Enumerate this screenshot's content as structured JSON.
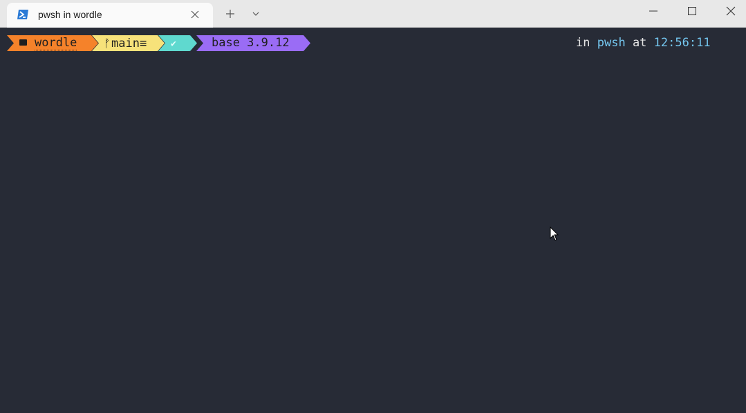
{
  "tab": {
    "title": "pwsh in wordle",
    "icon": "powershell-icon"
  },
  "titlebar": {
    "new_tab_icon": "plus-icon",
    "dropdown_icon": "chevron-down-icon",
    "minimize_icon": "minimize-icon",
    "maximize_icon": "maximize-icon",
    "close_icon": "close-icon"
  },
  "prompt": {
    "path": "wordle",
    "branch": "main≡",
    "status_icon": "check-icon",
    "python": "base 3.9.12"
  },
  "right_prompt": {
    "in_label": "in",
    "shell": "pwsh",
    "at_label": "at",
    "time": "12:56:11"
  },
  "colors": {
    "terminal_bg": "#272b36",
    "path_segment": "#f5822a",
    "git_segment": "#f7e27a",
    "status_segment": "#5fd9cf",
    "python_segment": "#9a6cf5",
    "accent_text": "#74c7f0"
  }
}
